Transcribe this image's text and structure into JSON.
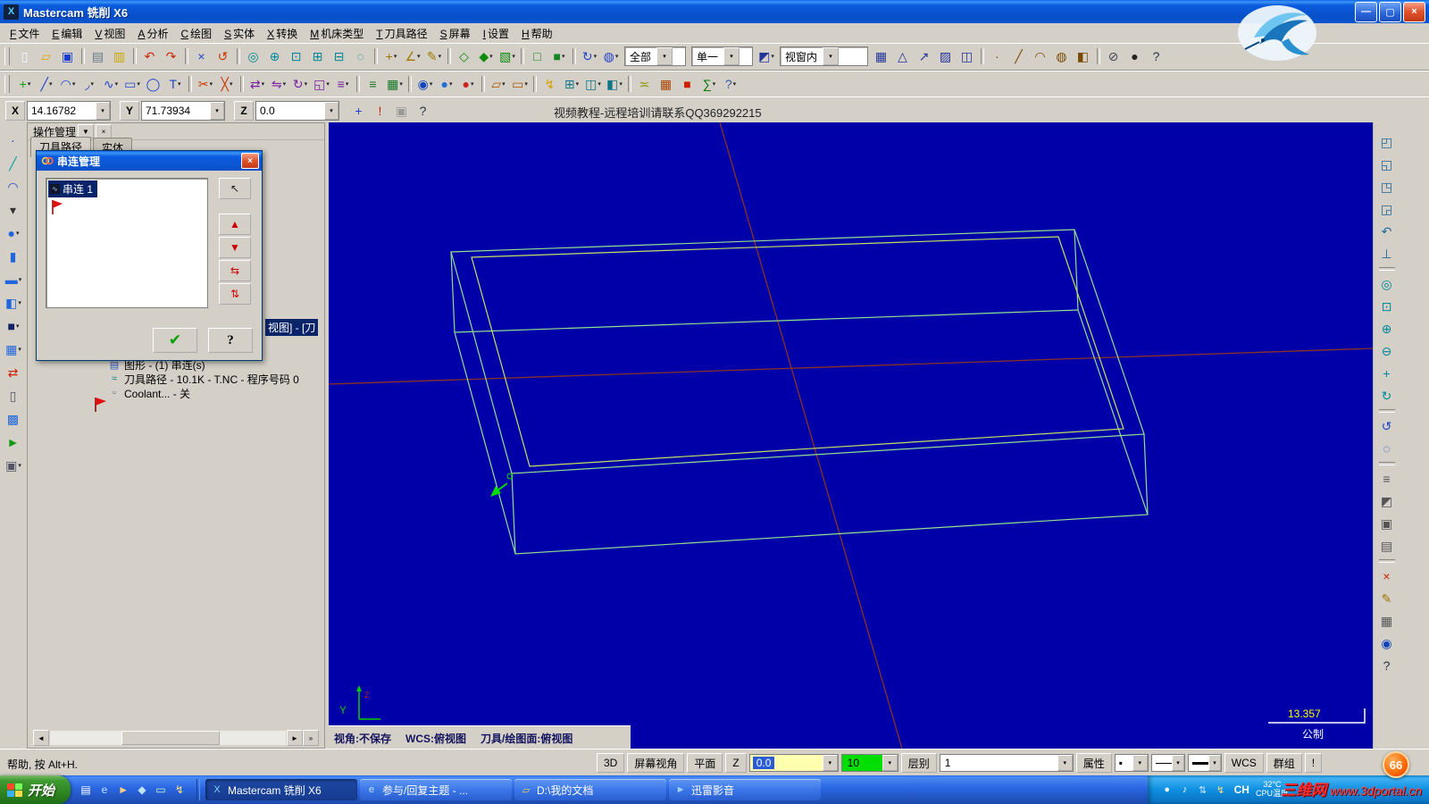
{
  "window": {
    "title": "Mastercam 铣削 X6",
    "icon_glyph": "X",
    "controls": [
      {
        "n": "minimize-button",
        "g": "—"
      },
      {
        "n": "maximize-button",
        "g": "▢"
      },
      {
        "n": "close-button",
        "g": "×"
      }
    ]
  },
  "menu": {
    "items": [
      {
        "n": "menu-file",
        "hk": "F",
        "label": "文件"
      },
      {
        "n": "menu-edit",
        "hk": "E",
        "label": "编辑"
      },
      {
        "n": "menu-view",
        "hk": "V",
        "label": "视图"
      },
      {
        "n": "menu-analyze",
        "hk": "A",
        "label": "分析"
      },
      {
        "n": "menu-create",
        "hk": "C",
        "label": "绘图"
      },
      {
        "n": "menu-solids",
        "hk": "S",
        "label": "实体"
      },
      {
        "n": "menu-xform",
        "hk": "X",
        "label": "转换"
      },
      {
        "n": "menu-machine-type",
        "hk": "M",
        "label": "机床类型"
      },
      {
        "n": "menu-toolpaths",
        "hk": "T",
        "label": "刀具路径"
      },
      {
        "n": "menu-screen",
        "hk": "S",
        "label": "屏幕"
      },
      {
        "n": "menu-settings",
        "hk": "I",
        "label": "设置"
      },
      {
        "n": "menu-help",
        "hk": "H",
        "label": "帮助"
      }
    ]
  },
  "toolbar1": {
    "icons_a": [
      {
        "n": "new-file-button",
        "g": "▯",
        "c": "#f5f5ff"
      },
      {
        "n": "open-file-button",
        "g": "▱",
        "c": "#e0a000"
      },
      {
        "n": "save-file-button",
        "g": "▣",
        "c": "#1a3ccc"
      },
      {
        "sep": 1
      },
      {
        "n": "print-button",
        "g": "▤",
        "c": "#667788"
      },
      {
        "n": "screen-note-button",
        "g": "▥",
        "c": "#c8a800"
      },
      {
        "sep": 1
      },
      {
        "n": "undo-button",
        "g": "↶",
        "c": "#cc2200"
      },
      {
        "n": "redo-button",
        "g": "↷",
        "c": "#cc2200"
      },
      {
        "sep": 1
      },
      {
        "n": "delete-entities-button",
        "g": "×",
        "c": "#2244cc"
      },
      {
        "n": "undelete-button",
        "g": "↺",
        "c": "#cc3300"
      },
      {
        "sep": 1
      },
      {
        "n": "zoom-window-button",
        "g": "◎",
        "c": "#008898"
      },
      {
        "n": "zoom-target-button",
        "g": "⊕",
        "c": "#008898"
      },
      {
        "n": "zoom-fit-button",
        "g": "⊡",
        "c": "#008898"
      },
      {
        "n": "zoom-in-button",
        "g": "⊞",
        "c": "#008898"
      },
      {
        "n": "unzoom-button",
        "g": "⊟",
        "c": "#008898"
      },
      {
        "n": "unzoom-80-button",
        "g": "◌",
        "c": "#008898"
      },
      {
        "sep": 1
      },
      {
        "n": "analyze-position-button",
        "g": "+",
        "c": "#a07800",
        "dd": "▾"
      },
      {
        "n": "analyze-distance-button",
        "g": "∠",
        "c": "#a07800",
        "dd": "▾"
      },
      {
        "n": "analyze-properties-button",
        "g": "✎",
        "c": "#a07800",
        "dd": "▾"
      },
      {
        "sep": 1
      },
      {
        "n": "gview-cube-wireframe-button",
        "g": "◇",
        "c": "#0a8a0a"
      },
      {
        "n": "gview-cube-shaded-button",
        "g": "◆",
        "c": "#0a8a0a",
        "dd": "▾"
      },
      {
        "n": "gview-cube-stock-button",
        "g": "▧",
        "c": "#0a8a0a",
        "dd": "▾"
      },
      {
        "sep": 1
      },
      {
        "n": "shading-off-button",
        "g": "□",
        "c": "#118822"
      },
      {
        "n": "shading-on-button",
        "g": "■",
        "c": "#118822",
        "dd": "▾"
      },
      {
        "sep": 1
      },
      {
        "n": "repaint-button",
        "g": "↻",
        "c": "#2244cc",
        "dd": "▾"
      },
      {
        "n": "blank-entities-button",
        "g": "◍",
        "c": "#2244cc",
        "dd": "▾"
      }
    ],
    "combo_all": "全部",
    "combo_single": "单一",
    "mid": [
      {
        "n": "selection-window-mode-button",
        "g": "◩",
        "c": "#223399",
        "dd": "▾"
      }
    ],
    "combo_window": "视窗内",
    "icons_b": [
      {
        "n": "select-in-window-button",
        "g": "▦",
        "c": "#223399"
      },
      {
        "n": "select-polygon-button",
        "g": "△",
        "c": "#223399"
      },
      {
        "n": "select-vector-button",
        "g": "↗",
        "c": "#223399"
      },
      {
        "n": "select-area-button",
        "g": "▨",
        "c": "#223399"
      },
      {
        "n": "select-validate-button",
        "g": "◫",
        "c": "#223399"
      },
      {
        "sep": 1
      },
      {
        "n": "quick-mask-points-button",
        "g": "∙",
        "c": "#7a4a00"
      },
      {
        "n": "quick-mask-lines-button",
        "g": "╱",
        "c": "#7a4a00"
      },
      {
        "n": "quick-mask-arcs-button",
        "g": "◠",
        "c": "#7a4a00"
      },
      {
        "n": "quick-mask-surfaces-button",
        "g": "◍",
        "c": "#7a4a00"
      },
      {
        "n": "quick-mask-solids-button",
        "g": "◧",
        "c": "#7a4a00"
      },
      {
        "sep": 1
      },
      {
        "n": "clear-selection-button",
        "g": "⊘",
        "c": "#444455"
      },
      {
        "n": "end-selection-button",
        "g": "●",
        "c": "#222222"
      },
      {
        "n": "toolbar-help-button",
        "g": "?",
        "c": "#223344"
      }
    ]
  },
  "toolbar2": {
    "icons": [
      {
        "n": "create-point-button",
        "g": "+",
        "c": "#00a000",
        "dd": "▾"
      },
      {
        "n": "create-line-button",
        "g": "╱",
        "c": "#2244cc",
        "dd": "▾"
      },
      {
        "n": "create-arc-button",
        "g": "◠",
        "c": "#2244cc",
        "dd": "▾"
      },
      {
        "n": "create-fillet-button",
        "g": "◞",
        "c": "#2244cc",
        "dd": "▾"
      },
      {
        "n": "create-spline-button",
        "g": "∿",
        "c": "#2244cc",
        "dd": "▾"
      },
      {
        "n": "create-rectangle-button",
        "g": "▭",
        "c": "#2244cc",
        "dd": "▾"
      },
      {
        "n": "create-ellipse-button",
        "g": "◯",
        "c": "#2244cc"
      },
      {
        "n": "create-text-button",
        "g": "T",
        "c": "#2244cc",
        "dd": "▾"
      },
      {
        "sep": 1
      },
      {
        "n": "trim-button",
        "g": "✂",
        "c": "#cc3300",
        "dd": "▾"
      },
      {
        "n": "break-button",
        "g": "╳",
        "c": "#cc3300",
        "dd": "▾"
      },
      {
        "sep": 1
      },
      {
        "n": "xform-translate-button",
        "g": "⇄",
        "c": "#7a1fa2",
        "dd": "▾"
      },
      {
        "n": "xform-mirror-button",
        "g": "⇋",
        "c": "#7a1fa2",
        "dd": "▾"
      },
      {
        "n": "xform-rotate-button",
        "g": "↻",
        "c": "#7a1fa2",
        "dd": "▾"
      },
      {
        "n": "xform-scale-button",
        "g": "◱",
        "c": "#7a1fa2",
        "dd": "▾"
      },
      {
        "n": "xform-offset-button",
        "g": "≡",
        "c": "#7a1fa2",
        "dd": "▾"
      },
      {
        "sep": 1
      },
      {
        "n": "levels-manager-button",
        "g": "≡",
        "c": "#117722"
      },
      {
        "n": "screen-grid-button",
        "g": "▦",
        "c": "#117722",
        "dd": "▾"
      },
      {
        "sep": 1
      },
      {
        "n": "gview-dynamic-button",
        "g": "◉",
        "c": "#1144bb",
        "dd": "▾"
      },
      {
        "n": "shading-ball-button",
        "g": "●",
        "c": "#1e6fd8",
        "dd": "▾"
      },
      {
        "n": "material-ball-button",
        "g": "●",
        "c": "#cc2222",
        "dd": "▾"
      },
      {
        "sep": 1
      },
      {
        "n": "plane-top-button",
        "g": "▱",
        "c": "#aa5500",
        "dd": "▾"
      },
      {
        "n": "plane-front-button",
        "g": "▭",
        "c": "#aa5500",
        "dd": "▾"
      },
      {
        "sep": 1
      },
      {
        "n": "analyze-dynamic-button",
        "g": "↯",
        "c": "#d4a000"
      },
      {
        "n": "wcs-menu-button",
        "g": "⊞",
        "c": "#117788",
        "dd": "▾"
      },
      {
        "n": "cplane-button",
        "g": "◫",
        "c": "#117788",
        "dd": "▾"
      },
      {
        "n": "tplane-button",
        "g": "◧",
        "c": "#117788",
        "dd": "▾"
      },
      {
        "sep": 1
      },
      {
        "n": "ruler-button",
        "g": "≍",
        "c": "#889900"
      },
      {
        "n": "calculator-button",
        "g": "▦",
        "c": "#aa4400"
      },
      {
        "n": "mcx-properties-button",
        "g": "■",
        "c": "#cc2200"
      },
      {
        "n": "notes-sigma-button",
        "g": "∑",
        "c": "#007700",
        "dd": "▾"
      },
      {
        "n": "whats-this-button",
        "g": "?",
        "c": "#3355aa",
        "dd": "▾"
      }
    ]
  },
  "coordbar": {
    "x_label": "X",
    "x_value": "14.16782",
    "y_label": "Y",
    "y_value": "71.73934",
    "z_label": "Z",
    "z_value": "0.0",
    "icons": [
      {
        "n": "fastpoint-button",
        "g": "+",
        "c": "#2244cc"
      },
      {
        "n": "regen-alert-button",
        "g": "!",
        "c": "#cc2200"
      },
      {
        "n": "locked-view-button",
        "g": "▣",
        "c": "#999999"
      },
      {
        "n": "coordbar-help-button",
        "g": "?",
        "c": "#223344"
      }
    ],
    "banner": "视频教程-远程培训请联系QQ369292215"
  },
  "left_strip": {
    "icons": [
      {
        "n": "autocursor-button",
        "g": "∙",
        "c": "#2244cc"
      },
      {
        "n": "sketch-line-button",
        "g": "╱",
        "c": "#00a0a0"
      },
      {
        "n": "sketch-arc-button",
        "g": "◠",
        "c": "#2244cc"
      },
      {
        "n": "expand-tools-button",
        "g": "▾",
        "c": "#333333"
      },
      {
        "n": "surface-sphere-button",
        "g": "●",
        "c": "#2266dd",
        "dd": "▾"
      },
      {
        "n": "surface-cylinder-button",
        "g": "▮",
        "c": "#2266dd"
      },
      {
        "n": "surface-plate-button",
        "g": "▬",
        "c": "#2266dd",
        "dd": "▾"
      },
      {
        "n": "solid-extrude-button",
        "g": "◧",
        "c": "#2266dd",
        "dd": "▾"
      },
      {
        "n": "solid-primitive-button",
        "g": "■",
        "c": "#112266",
        "dd": "▾"
      },
      {
        "n": "mesh-grid-button",
        "g": "▦",
        "c": "#2266dd",
        "dd": "▾"
      },
      {
        "n": "swap-views-button",
        "g": "⇄",
        "c": "#cc2200"
      },
      {
        "n": "document-small-button",
        "g": "▯",
        "c": "#555566"
      },
      {
        "n": "pattern-button",
        "g": "▩",
        "c": "#2266dd"
      },
      {
        "n": "fly-through-button",
        "g": "►",
        "c": "#119911"
      },
      {
        "n": "machine-sim-button",
        "g": "▣",
        "c": "#555566",
        "dd": "▾"
      }
    ]
  },
  "right_strip": {
    "icons": [
      {
        "n": "gview-top-button",
        "g": "◰",
        "c": "#226699"
      },
      {
        "n": "gview-front-button",
        "g": "◱",
        "c": "#226699"
      },
      {
        "n": "gview-side-button",
        "g": "◳",
        "c": "#226699"
      },
      {
        "n": "gview-iso-button",
        "g": "◲",
        "c": "#226699"
      },
      {
        "n": "gview-previous-button",
        "g": "↶",
        "c": "#226699"
      },
      {
        "n": "gview-normal-button",
        "g": "⊥",
        "c": "#226699"
      },
      {
        "sep": 1
      },
      {
        "n": "zoom-window-side-button",
        "g": "◎",
        "c": "#008898"
      },
      {
        "n": "zoom-fit-side-button",
        "g": "⊡",
        "c": "#008898"
      },
      {
        "n": "zoom-in-side-button",
        "g": "⊕",
        "c": "#008898"
      },
      {
        "n": "zoom-out-side-button",
        "g": "⊖",
        "c": "#008898"
      },
      {
        "n": "pan-side-button",
        "g": "+",
        "c": "#008898"
      },
      {
        "n": "rotate-side-button",
        "g": "↻",
        "c": "#008898"
      },
      {
        "sep": 1
      },
      {
        "n": "repaint-side-button",
        "g": "↺",
        "c": "#2244cc"
      },
      {
        "n": "blank-side-button",
        "g": "◌",
        "c": "#2244cc"
      },
      {
        "sep": 1
      },
      {
        "n": "levels-side-button",
        "g": "≡",
        "c": "#555555"
      },
      {
        "n": "attributes-side-button",
        "g": "◩",
        "c": "#555555"
      },
      {
        "n": "groups-side-button",
        "g": "▣",
        "c": "#555555"
      },
      {
        "n": "viewsheets-side-button",
        "g": "▤",
        "c": "#555555"
      },
      {
        "sep": 1
      },
      {
        "n": "delete-side-button",
        "g": "×",
        "c": "#cc2200"
      },
      {
        "n": "analyze-side-button",
        "g": "✎",
        "c": "#a07800"
      },
      {
        "n": "grid-side-button",
        "g": "▦",
        "c": "#555555"
      },
      {
        "n": "world-side-button",
        "g": "◉",
        "c": "#1144bb"
      },
      {
        "n": "help-side-button",
        "g": "?",
        "c": "#223344"
      }
    ]
  },
  "ops": {
    "title": "操作管理",
    "menu_glyph": "▼",
    "close_glyph": "×",
    "tabs": [
      {
        "n": "tab-toolpaths",
        "label": "刀具路径",
        "active": 1
      },
      {
        "n": "tab-solids",
        "label": "实体"
      }
    ],
    "partial_selected": "视图] - [刀",
    "tree": [
      {
        "n": "tree-item-geometry",
        "icon": "▤",
        "ic": "#3355bb",
        "label": "图形 - (1) 串连(s)"
      },
      {
        "n": "tree-item-toolpath-file",
        "icon": "≈",
        "ic": "#008888",
        "label": "刀具路径 - 10.1K - T.NC - 程序号码 0"
      },
      {
        "n": "tree-item-coolant",
        "icon": "▫",
        "ic": "#666677",
        "label": "Coolant... - 关"
      }
    ],
    "scroll": {
      "left": "◄",
      "right": "►",
      "more": "»"
    }
  },
  "chain_dialog": {
    "title": "串连管理",
    "close_glyph": "×",
    "items": [
      {
        "n": "chain-list-item",
        "icon": "∿",
        "label": "串连 1"
      }
    ],
    "side_buttons": [
      {
        "n": "chain-pick-button",
        "g": "↖",
        "c": "#222222"
      },
      {
        "n": "chain-move-up-button",
        "g": "▲",
        "c": "#cc0000",
        "gap": 14
      },
      {
        "n": "chain-move-down-button",
        "g": "▼",
        "c": "#cc0000"
      },
      {
        "n": "chain-reverse-button",
        "g": "⇆",
        "c": "#cc0000"
      },
      {
        "n": "chain-rechain-button",
        "g": "⇅",
        "c": "#cc0000"
      }
    ],
    "ok_glyph": "✔",
    "help_glyph": "?"
  },
  "viewport": {
    "view_status": "视角:不保存",
    "wcs_status": "WCS:俯视图",
    "plane_status": "刀具/绘图面:俯视图",
    "scale_value": "13.357",
    "units_label": "公制",
    "gnomon_y": "Y",
    "gnomon_z": "Z"
  },
  "ribbon": {
    "help_hint": "帮助, 按 Alt+H.",
    "gview_3d": "3D",
    "screen_view": "屏幕视角",
    "plane": "平面",
    "z_label": "Z",
    "z_value": "0.0",
    "color_value": "10",
    "level_label": "层别",
    "level_value": "1",
    "attributes": "属性",
    "point_sample": "▪",
    "wcs": "WCS",
    "groups": "群组",
    "alert": "!"
  },
  "taskbar": {
    "start_label": "开始",
    "quick_launch": [
      {
        "n": "quicklaunch-show-desktop",
        "g": "▤",
        "c": "#ffffff"
      },
      {
        "n": "quicklaunch-ie",
        "g": "e",
        "c": "#bfe3ff"
      },
      {
        "n": "quicklaunch-media-player",
        "g": "►",
        "c": "#ffd080"
      },
      {
        "n": "quicklaunch-qq",
        "g": "◆",
        "c": "#bfe2ff"
      },
      {
        "n": "quicklaunch-mail",
        "g": "▭",
        "c": "#c9f7c9"
      },
      {
        "n": "quicklaunch-thunder",
        "g": "↯",
        "c": "#ffe080"
      }
    ],
    "apps": [
      {
        "n": "task-mastercam",
        "icon": "X",
        "ic": "#7fd4ff",
        "label": "Mastercam 铣削 X6",
        "active": 1
      },
      {
        "n": "task-browser-topic",
        "icon": "e",
        "ic": "#bfe3ff",
        "label": "参与/回复主题 - ..."
      },
      {
        "n": "task-my-documents",
        "icon": "▱",
        "ic": "#ffd54a",
        "label": "D:\\我的文档"
      },
      {
        "n": "task-thunder-player",
        "icon": "►",
        "ic": "#9fd0ff",
        "label": "迅雷影音"
      }
    ],
    "tray": {
      "icons": [
        {
          "n": "tray-qq-icon",
          "g": "●",
          "c": "#e8f4ff"
        },
        {
          "n": "tray-volume-icon",
          "g": "♪",
          "c": "#ffffff"
        },
        {
          "n": "tray-network-icon",
          "g": "⇅",
          "c": "#cfe8ff"
        },
        {
          "n": "tray-thunder-icon",
          "g": "↯",
          "c": "#ffe080"
        }
      ],
      "ime": "CH",
      "temp_value": "32°C",
      "temp_label": "CPU温度"
    }
  },
  "watermark": {
    "site": "三维网",
    "url": "www.3dportal.cn"
  },
  "badge": {
    "value": "66"
  },
  "colors": {
    "viewport_bg": "#0000A8",
    "wireframe_green": "#8FE08F",
    "chain_highlight": "#C8E060",
    "axis_red": "#8A3324",
    "selection_blue": "#0A246A",
    "taskbar_blue": "#2763E4",
    "start_green": "#3F9C31",
    "chain_marker_green": "#00DD00",
    "scale_yellow": "#FFFF00"
  }
}
